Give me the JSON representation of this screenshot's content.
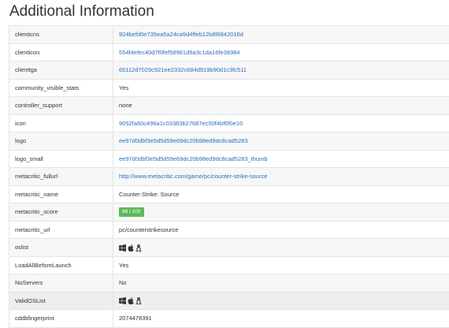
{
  "section_title": "Additional Information",
  "rows": [
    {
      "key": "clienticns",
      "value": "924befd0e735ea5a24ca9d4ffeb12b8f6842016d",
      "type": "link"
    },
    {
      "key": "clienticon",
      "value": "554f4efec40d7f0fef58961d9a3c1da16fe38984",
      "type": "link"
    },
    {
      "key": "clienttga",
      "value": "65112d7029c921ee2332c684d919b90d1c3fc511",
      "type": "link"
    },
    {
      "key": "community_visible_stats",
      "value": "Yes",
      "type": "text"
    },
    {
      "key": "controller_support",
      "value": "none",
      "type": "text"
    },
    {
      "key": "icon",
      "value": "9052fa60c496a1c03383b27687ec50f4bf0f0e10",
      "type": "link"
    },
    {
      "key": "logo",
      "value": "ee97d0dbf3e5d5d59e69dc20b98ed9dc8cad5283",
      "type": "link"
    },
    {
      "key": "logo_small",
      "value": "ee97d0dbf3e5d5d59e69dc20b98ed9dc8cad5283_thumb",
      "type": "link"
    },
    {
      "key": "metacritic_fullurl",
      "value": "http://www.metacritic.com/game/pc/counter-strike-source",
      "type": "link"
    },
    {
      "key": "metacritic_name",
      "value": "Counter-Strike: Source",
      "type": "text"
    },
    {
      "key": "metacritic_score",
      "value": "88 / 100",
      "type": "badge"
    },
    {
      "key": "metacritic_url",
      "value": "pc/counterstrikesource",
      "type": "text"
    },
    {
      "key": "oslist",
      "icons": [
        "windows-icon",
        "apple-icon",
        "linux-icon"
      ],
      "type": "icons"
    },
    {
      "key": "LoadAllBeforeLaunch",
      "value": "Yes",
      "type": "text"
    },
    {
      "key": "NoServers",
      "value": "No",
      "type": "text"
    },
    {
      "key": "ValidOSList",
      "icons": [
        "windows-icon",
        "apple-icon",
        "linux-icon"
      ],
      "type": "icons"
    },
    {
      "key": "cddbfingerprint",
      "value": "2074478391",
      "type": "text"
    }
  ],
  "colors": {
    "link": "#2a6fb8",
    "badge_bg": "#5cb85c",
    "row_alt_bg": "#f7f7f7",
    "row_highlight_bg": "#eeeeee",
    "border": "#e4e4e4"
  }
}
